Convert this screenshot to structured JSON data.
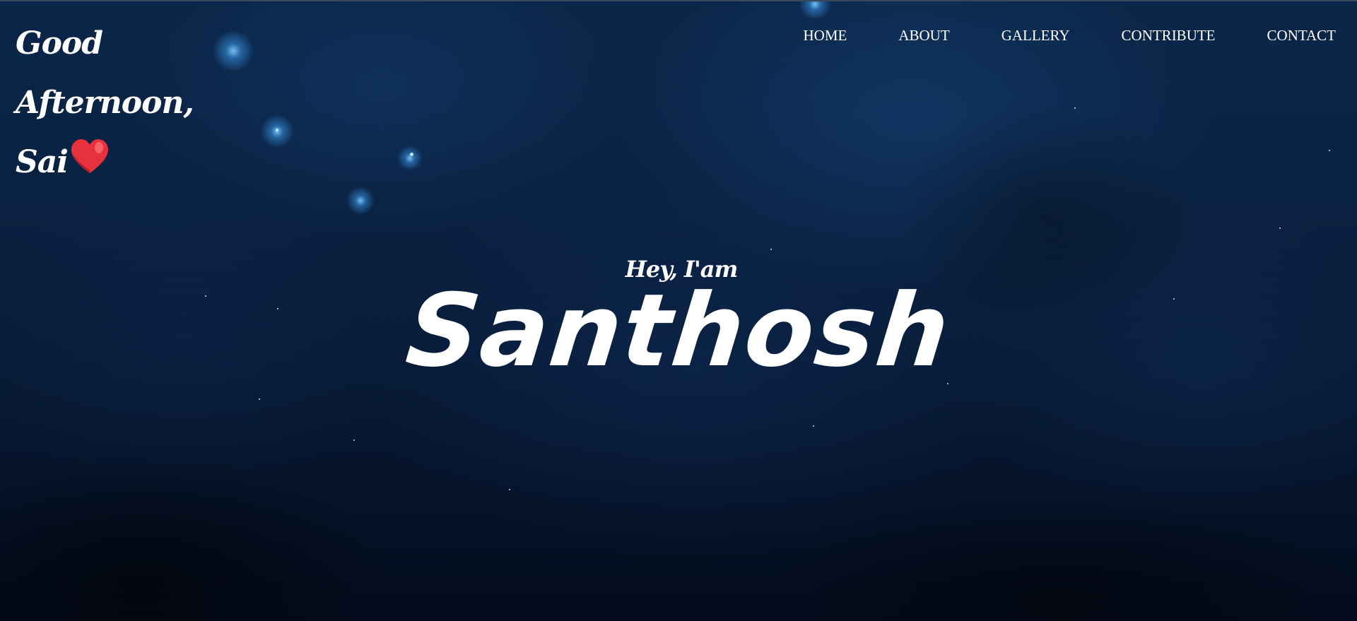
{
  "greeting": {
    "line1": "Good Afternoon,",
    "line2": "Sai",
    "icon": "heart-icon",
    "icon_color": "#e8313f"
  },
  "nav": {
    "items": [
      {
        "label": "HOME"
      },
      {
        "label": "ABOUT"
      },
      {
        "label": "GALLERY"
      },
      {
        "label": "CONTRIBUTE"
      },
      {
        "label": "CONTACT"
      }
    ]
  },
  "intro": {
    "small": "Hey, I'am",
    "name": "Santhosh"
  },
  "colors": {
    "background": "#0a2141",
    "text": "#ffffff"
  }
}
